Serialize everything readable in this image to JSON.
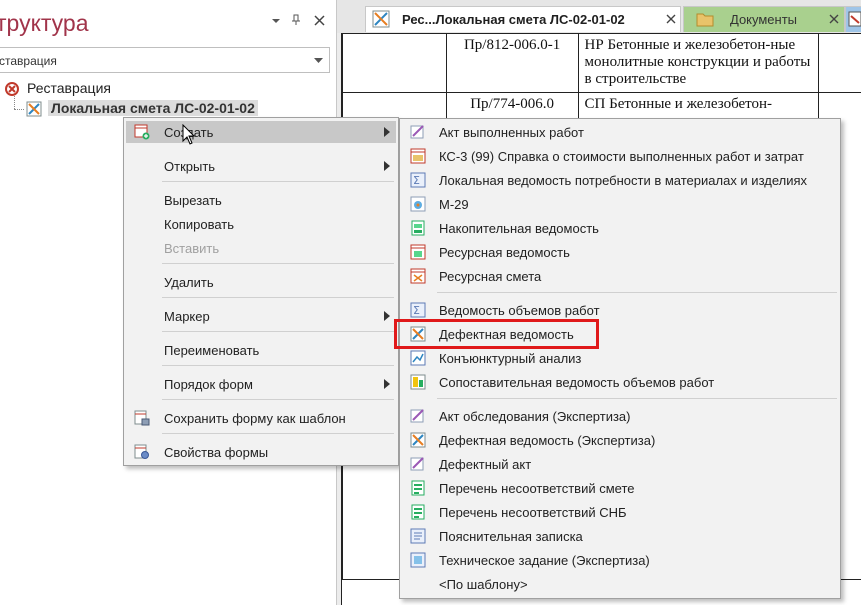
{
  "left_panel": {
    "title": "труктура",
    "pin_icon": "pin-icon",
    "close_icon": "close-icon",
    "dropdown_icon": "dropdown-arrow-icon",
    "combo_value": "ставрация",
    "tree": {
      "root_label": "Реставрация",
      "child_label": "Локальная смета ЛС-02-01-02"
    }
  },
  "tabs": [
    {
      "label": "Рес...Локальная смета ЛС-02-01-02",
      "icon": "estimate-icon",
      "active": true
    },
    {
      "label": "Документы",
      "icon": "folder-icon",
      "active": false
    },
    {
      "label": "",
      "icon": "document-icon",
      "active": false
    }
  ],
  "document_table": {
    "rows": [
      {
        "code": "Пр/812-006.0-1",
        "text": "НР Бетонные и железобетон-ные монолитные конструкции и работы в строительстве"
      },
      {
        "code": "Пр/774-006.0",
        "text": "СП Бетонные и железобетон-"
      }
    ]
  },
  "context_menu": {
    "items": [
      {
        "label": "Создать",
        "submenu": true,
        "hot": true,
        "icon": "create-icon"
      },
      {
        "label": "Открыть",
        "submenu": true
      },
      {
        "label": "Вырезать"
      },
      {
        "label": "Копировать"
      },
      {
        "label": "Вставить",
        "disabled": true
      },
      {
        "label": "Удалить"
      },
      {
        "label": "Маркер",
        "submenu": true
      },
      {
        "label": "Переименовать"
      },
      {
        "label": "Порядок форм",
        "submenu": true
      },
      {
        "label": "Сохранить форму как шаблон",
        "icon": "save-template-icon"
      },
      {
        "label": "Свойства формы",
        "icon": "properties-icon"
      }
    ]
  },
  "submenu": {
    "items": [
      {
        "label": "Акт выполненных работ",
        "icon": "act-icon"
      },
      {
        "label": "КС-3 (99) Справка о стоимости выполненных работ и затрат",
        "icon": "ks3-icon"
      },
      {
        "label": "Локальная ведомость потребности в материалах и изделиях",
        "icon": "sum-icon"
      },
      {
        "label": "М-29",
        "icon": "m29-icon"
      },
      {
        "label": "Накопительная ведомость",
        "icon": "accumulate-icon"
      },
      {
        "label": "Ресурсная ведомость",
        "icon": "resource-icon"
      },
      {
        "label": "Ресурсная смета",
        "icon": "resource-estimate-icon"
      },
      {
        "label": "Ведомость объемов работ",
        "icon": "volume-icon"
      },
      {
        "label": "Дефектная ведомость",
        "icon": "defect-icon"
      },
      {
        "label": "Конъюнктурный анализ",
        "icon": "analysis-icon"
      },
      {
        "label": "Сопоставительная ведомость объемов работ",
        "icon": "compare-icon"
      },
      {
        "label": "Акт обследования (Экспертиза)",
        "icon": "inspection-icon"
      },
      {
        "label": "Дефектная ведомость (Экспертиза)",
        "icon": "defect-expert-icon"
      },
      {
        "label": "Дефектный акт",
        "icon": "defect-act-icon"
      },
      {
        "label": "Перечень несоответствий смете",
        "icon": "list-icon"
      },
      {
        "label": "Перечень несоответствий СНБ",
        "icon": "list-snb-icon"
      },
      {
        "label": "Пояснительная записка",
        "icon": "note-icon"
      },
      {
        "label": "Техническое задание (Экспертиза)",
        "icon": "task-icon"
      },
      {
        "label": "<По шаблону>",
        "icon": ""
      }
    ]
  },
  "colors": {
    "accent": "#a1344a",
    "highlight": "#e0191a",
    "tab_documents": "#a9d08e"
  }
}
